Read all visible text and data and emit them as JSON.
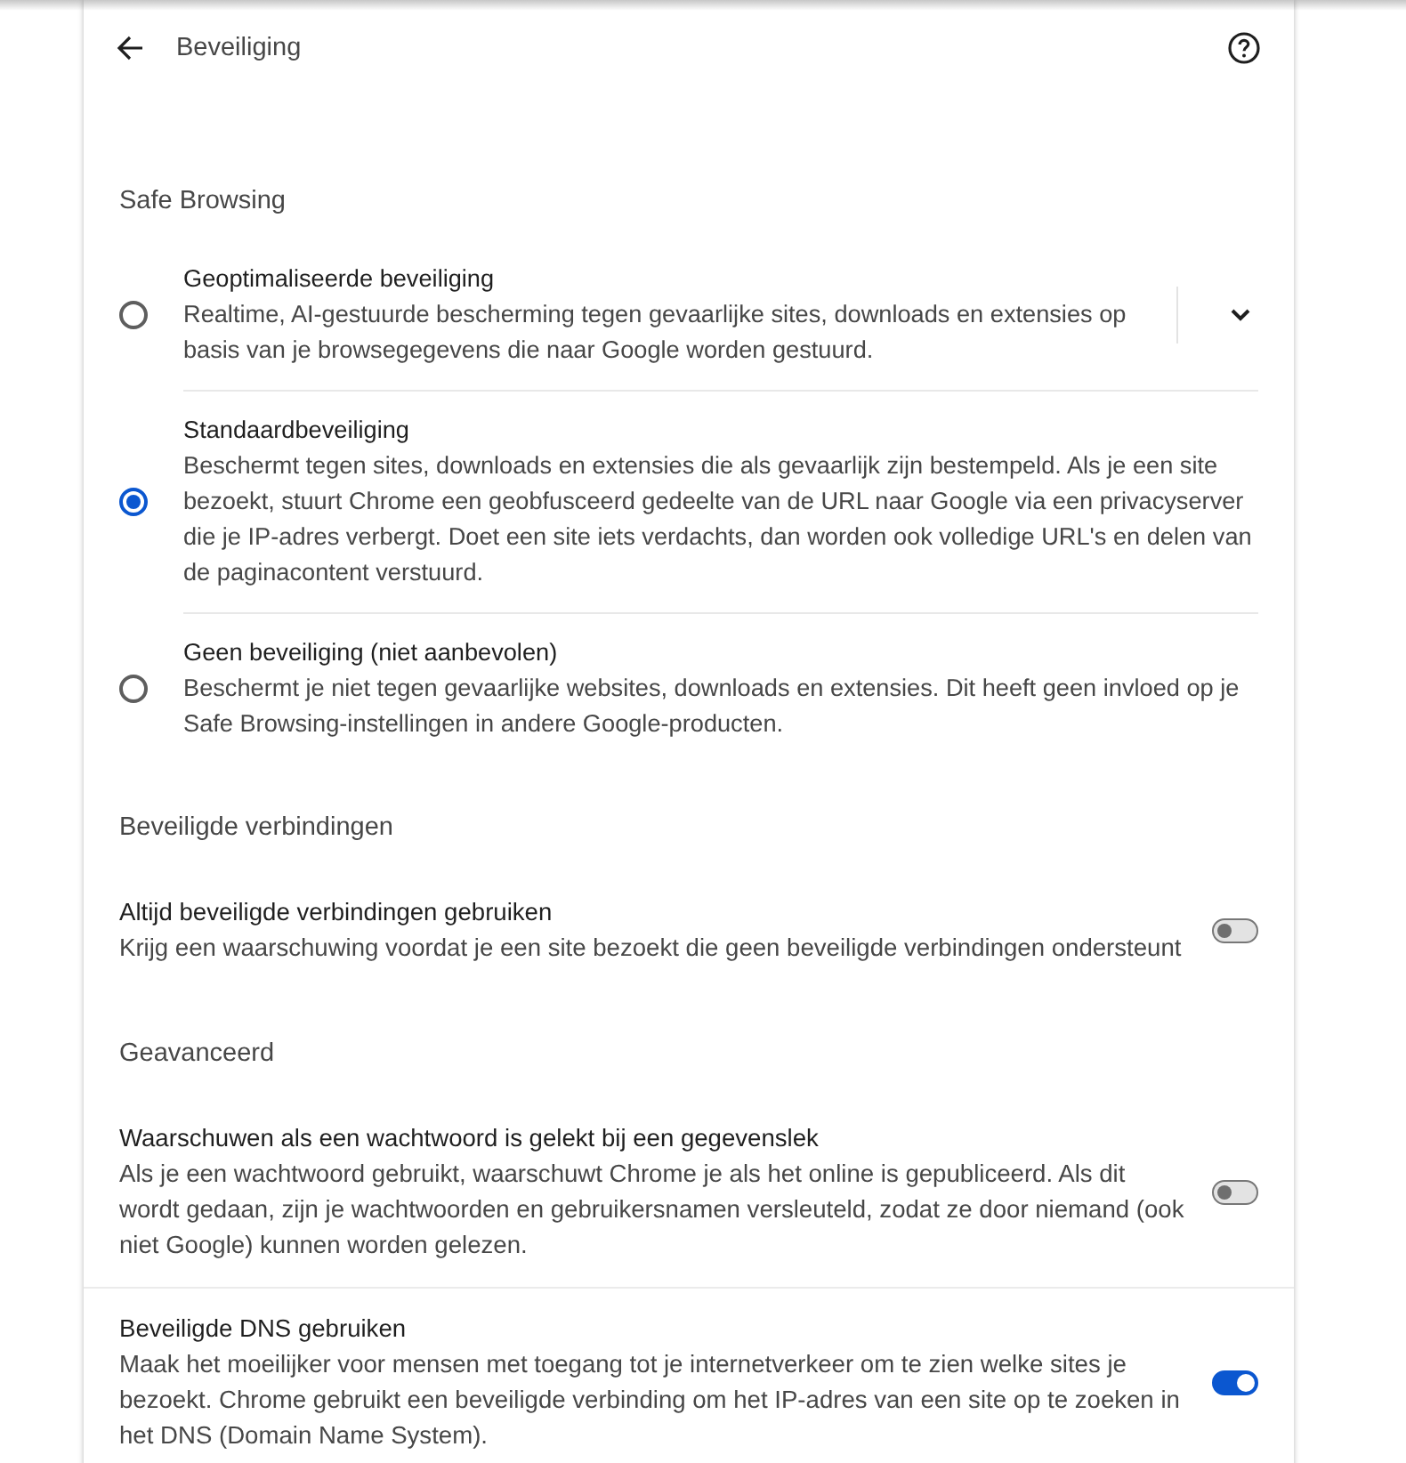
{
  "header": {
    "title": "Beveiliging"
  },
  "sections": [
    {
      "heading": "Safe Browsing",
      "items": [
        {
          "kind": "radio",
          "title": "Geoptimaliseerde beveiliging",
          "description": "Realtime, AI-gestuurde bescherming tegen gevaarlijke sites, downloads en extensies op basis van je browsegegevens die naar Google worden gestuurd.",
          "selected": false,
          "expandable": true
        },
        {
          "kind": "radio",
          "title": "Standaardbeveiliging",
          "description": "Beschermt tegen sites, downloads en extensies die als gevaarlijk zijn bestempeld. Als je een site bezoekt, stuurt Chrome een geobfusceerd gedeelte van de URL naar Google via een privacyserver die je IP-adres verbergt. Doet een site iets verdachts, dan worden ook volledige URL's en delen van de paginacontent verstuurd.",
          "selected": true,
          "expandable": false
        },
        {
          "kind": "radio",
          "title": "Geen beveiliging (niet aanbevolen)",
          "description": "Beschermt je niet tegen gevaarlijke websites, downloads en extensies. Dit heeft geen invloed op je Safe Browsing-instellingen in andere Google-producten.",
          "selected": false,
          "expandable": false
        }
      ]
    },
    {
      "heading": "Beveiligde verbindingen",
      "items": [
        {
          "kind": "toggle",
          "title": "Altijd beveiligde verbindingen gebruiken",
          "description": "Krijg een waarschuwing voordat je een site bezoekt die geen beveiligde verbindingen ondersteunt",
          "on": false
        }
      ]
    },
    {
      "heading": "Geavanceerd",
      "items": [
        {
          "kind": "toggle",
          "title": "Waarschuwen als een wachtwoord is gelekt bij een gegevenslek",
          "description": "Als je een wachtwoord gebruikt, waarschuwt Chrome je als het online is gepubliceerd. Als dit wordt gedaan, zijn je wachtwoorden en gebruikersnamen versleuteld, zodat ze door niemand (ook niet Google) kunnen worden gelezen.",
          "on": false
        },
        {
          "kind": "toggle",
          "title": "Beveiligde DNS gebruiken",
          "description": "Maak het moeilijker voor mensen met toegang tot je internetverkeer om te zien welke sites je bezoekt. Chrome gebruikt een beveiligde verbinding om het IP-adres van een site op te zoeken in het DNS (Domain Name System).",
          "on": true
        }
      ]
    }
  ]
}
